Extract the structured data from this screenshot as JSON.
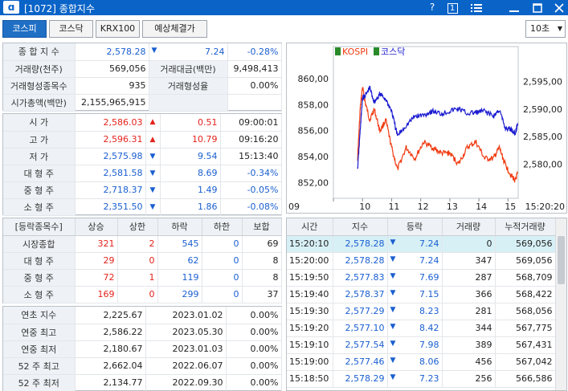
{
  "window": {
    "title": "[1072] 종합지수",
    "help": "?",
    "num_icon": "1"
  },
  "tabs": [
    {
      "label": "코스피"
    },
    {
      "label": "코스닥"
    },
    {
      "label": "KRX100"
    },
    {
      "label": "예상체결가"
    }
  ],
  "interval": "10초",
  "summary": {
    "index_label": "종 합 지 수",
    "index_value": "2,578.28",
    "index_change": "7.24",
    "index_pct": "-0.28%",
    "volume_label": "거래량(천주)",
    "volume_value": "569,056",
    "amount_label": "거래대금(백만)",
    "amount_value": "9,498,413",
    "formed_label": "거래형성종목수",
    "formed_value": "935",
    "formed_rate_label": "거래형성율",
    "formed_rate_value": "0.00%",
    "mcap_label": "시가총액(백만)",
    "mcap_value": "2,155,965,915"
  },
  "ohlc": [
    {
      "label": "시      가",
      "value": "2,586.03",
      "dir": "up",
      "change": "0.51",
      "extra": "09:00:01"
    },
    {
      "label": "고      가",
      "value": "2,596.31",
      "dir": "up",
      "change": "10.79",
      "extra": "09:16:20"
    },
    {
      "label": "저      가",
      "value": "2,575.98",
      "dir": "dn",
      "change": "9.54",
      "extra": "15:13:40"
    },
    {
      "label": "대 형 주",
      "value": "2,581.58",
      "dir": "dn",
      "change": "8.69",
      "extra": "-0.34%"
    },
    {
      "label": "중 형 주",
      "value": "2,718.37",
      "dir": "dn",
      "change": "1.49",
      "extra": "-0.05%"
    },
    {
      "label": "소 형 주",
      "value": "2,351.50",
      "dir": "dn",
      "change": "1.86",
      "extra": "-0.08%"
    }
  ],
  "updown": {
    "headers": [
      "[등락종목수]",
      "상승",
      "상한",
      "하락",
      "하한",
      "보합"
    ],
    "rows": [
      {
        "label": "시장종합",
        "v": [
          "321",
          "2",
          "545",
          "0",
          "69"
        ]
      },
      {
        "label": "대 형 주",
        "v": [
          "29",
          "0",
          "62",
          "0",
          "8"
        ]
      },
      {
        "label": "중 형 주",
        "v": [
          "72",
          "1",
          "119",
          "0",
          "8"
        ]
      },
      {
        "label": "소 형 주",
        "v": [
          "169",
          "0",
          "299",
          "0",
          "37"
        ]
      }
    ]
  },
  "yearly": [
    {
      "label": "연초  지수",
      "value": "2,225.67",
      "date": "2023.01.02",
      "pct": "0.00%"
    },
    {
      "label": "연중  최고",
      "value": "2,586.22",
      "date": "2023.05.30",
      "pct": "0.00%"
    },
    {
      "label": "연중  최저",
      "value": "2,180.67",
      "date": "2023.01.03",
      "pct": "0.00%"
    },
    {
      "label": "52 주 최고",
      "value": "2,662.04",
      "date": "2022.06.07",
      "pct": "0.00%"
    },
    {
      "label": "52 주 최저",
      "value": "2,134.77",
      "date": "2022.09.30",
      "pct": "0.00%"
    }
  ],
  "ticks": {
    "headers": [
      "시간",
      "지수",
      "등락",
      "거래량",
      "누적거래량"
    ],
    "rows": [
      {
        "time": "15:20:10",
        "index": "2,578.28",
        "change": "7.24",
        "vol": "0",
        "cum": "569,056"
      },
      {
        "time": "15:20:00",
        "index": "2,578.28",
        "change": "7.24",
        "vol": "347",
        "cum": "569,056"
      },
      {
        "time": "15:19:50",
        "index": "2,577.83",
        "change": "7.69",
        "vol": "287",
        "cum": "568,709"
      },
      {
        "time": "15:19:40",
        "index": "2,578.37",
        "change": "7.15",
        "vol": "366",
        "cum": "568,422"
      },
      {
        "time": "15:19:30",
        "index": "2,577.29",
        "change": "8.23",
        "vol": "281",
        "cum": "568,056"
      },
      {
        "time": "15:19:20",
        "index": "2,577.10",
        "change": "8.42",
        "vol": "344",
        "cum": "567,775"
      },
      {
        "time": "15:19:10",
        "index": "2,577.54",
        "change": "7.98",
        "vol": "389",
        "cum": "567,431"
      },
      {
        "time": "15:19:00",
        "index": "2,577.46",
        "change": "8.06",
        "vol": "456",
        "cum": "567,042"
      },
      {
        "time": "15:18:50",
        "index": "2,578.29",
        "change": "7.23",
        "vol": "256",
        "cum": "566,586"
      }
    ]
  },
  "chart_data": {
    "type": "line",
    "legend": [
      "KOSPI",
      "코스닥"
    ],
    "x_ticks": [
      "09",
      "10",
      "11",
      "12",
      "13",
      "14",
      "15",
      "15:20:20"
    ],
    "left_axis": {
      "ticks": [
        "860,00",
        "858,00",
        "856,00",
        "854,00",
        "852,00"
      ],
      "ylim": [
        850.8,
        861.6
      ]
    },
    "right_axis": {
      "ticks": [
        "2,595,00",
        "2,590,00",
        "2,585,00",
        "2,580,00"
      ],
      "ylim": [
        2573.8,
        2599.3
      ]
    },
    "series": [
      {
        "name": "KOSPI",
        "color": "#f03a10",
        "axis": "right",
        "x": [
          9.83,
          9.92,
          10.0,
          10.1,
          10.25,
          10.4,
          10.6,
          10.8,
          11.0,
          11.2,
          11.5,
          11.8,
          12.1,
          12.4,
          12.7,
          13.0,
          13.3,
          13.6,
          13.9,
          14.2,
          14.5,
          14.7,
          14.9,
          15.1,
          15.25,
          15.33
        ],
        "values": [
          2581,
          2590,
          2594,
          2591,
          2588,
          2590,
          2586,
          2588,
          2583,
          2579,
          2583,
          2581,
          2584,
          2583,
          2582,
          2582,
          2580,
          2583,
          2584,
          2581,
          2581,
          2583,
          2580,
          2578,
          2577,
          2578.3
        ]
      },
      {
        "name": "코스닥",
        "color": "#1a1ad0",
        "axis": "left",
        "x": [
          9.83,
          9.92,
          10.0,
          10.1,
          10.25,
          10.4,
          10.6,
          10.8,
          11.0,
          11.2,
          11.5,
          11.8,
          12.1,
          12.4,
          12.7,
          13.0,
          13.3,
          13.6,
          13.9,
          14.2,
          14.5,
          14.7,
          14.9,
          15.1,
          15.25,
          15.33
        ],
        "values": [
          853,
          856,
          858.5,
          858.7,
          859.3,
          858.2,
          858.8,
          858.4,
          857.5,
          855.6,
          856.4,
          857.1,
          857.2,
          857.5,
          857.3,
          857.5,
          857.7,
          857.3,
          857.4,
          857.5,
          857.1,
          857.6,
          856.2,
          856.1,
          855.8,
          856.5
        ]
      }
    ]
  }
}
